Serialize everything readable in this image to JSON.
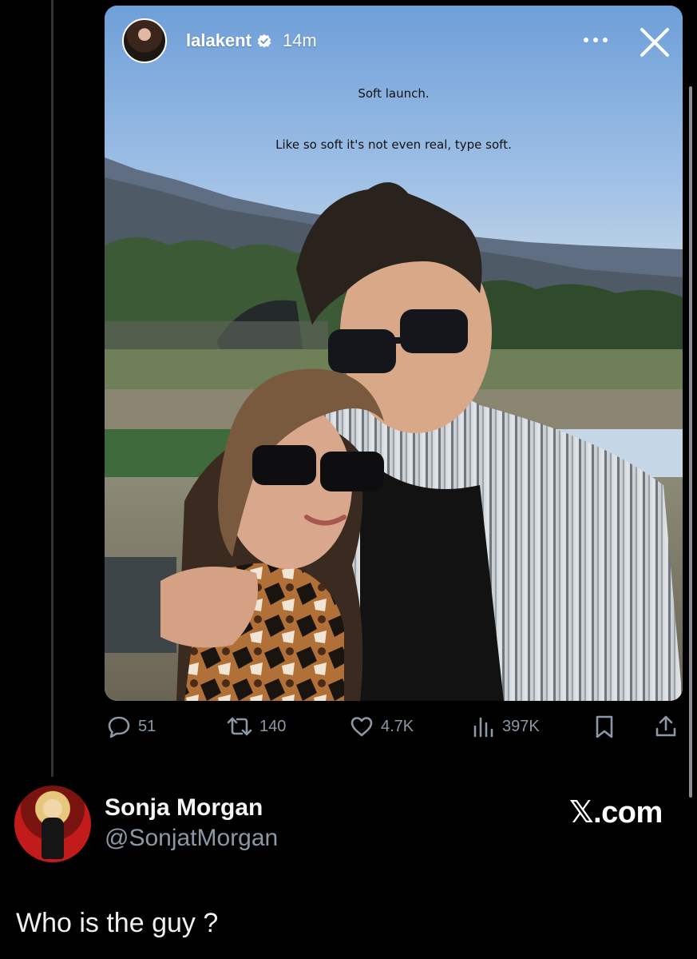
{
  "story": {
    "username": "lalakent",
    "time_ago": "14m",
    "caption_line1": "Soft launch.",
    "caption_line2": "Like so soft it's not even real, type soft.",
    "icons": {
      "verified": "verified-badge-icon",
      "more": "more-options-icon",
      "close": "close-icon"
    }
  },
  "actions": {
    "replies": "51",
    "reposts": "140",
    "likes": "4.7K",
    "views": "397K"
  },
  "quote": {
    "author_name": "Sonja Morgan",
    "author_handle": "@SonjatMorgan",
    "text": "Who is the guy ?"
  },
  "brand": {
    "watermark": "𝕏.com"
  },
  "colors": {
    "background": "#000000",
    "muted_text": "#8b98a5",
    "primary_text": "#e7e9ea"
  }
}
